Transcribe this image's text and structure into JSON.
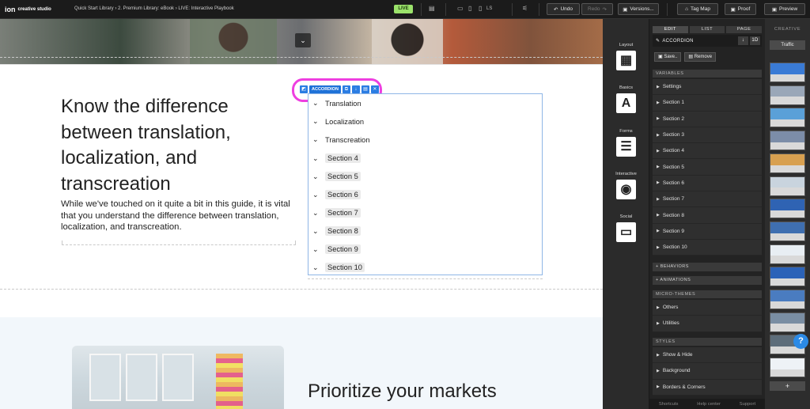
{
  "topbar": {
    "logo": "ion",
    "logo_sub": "creative studio",
    "breadcrumb": "Quick Start Library  ›  2. Premium Library: eBook  ›  LIVE: Interactive Playbook",
    "live_badge": "LIVE",
    "device_label": "LS",
    "undo": "Undo",
    "redo": "Redo",
    "versions": "Versions...",
    "tag_map": "Tag Map",
    "proof": "Proof",
    "preview": "Preview"
  },
  "canvas": {
    "headline": "Know the difference between translation, localization, and transcreation",
    "body": "While we've touched on it quite a bit in this guide, it is vital that you understand the difference between translation, localization, and transcreation.",
    "toolbar_label": "ACCORDION",
    "accordion_items": [
      "Translation",
      "Localization",
      "Transcreation",
      "Section 4",
      "Section 5",
      "Section 6",
      "Section 7",
      "Section 8",
      "Section 9",
      "Section 10"
    ],
    "second_headline": "Prioritize your markets"
  },
  "element_panel": {
    "groups": [
      {
        "label": "Layout",
        "icon": "layout-icon"
      },
      {
        "label": "Basics",
        "icon": "text-icon",
        "glyph": "A"
      },
      {
        "label": "Forms",
        "icon": "form-icon"
      },
      {
        "label": "Interactive",
        "icon": "play-icon"
      },
      {
        "label": "Social",
        "icon": "chat-icon"
      }
    ]
  },
  "right_panel": {
    "tabs": [
      "EDIT",
      "LIST",
      "PAGE"
    ],
    "element_name": "ACCORDION",
    "badge_1d": "1D",
    "save": "Save..",
    "remove": "Remove",
    "variables_title": "VARIABLES",
    "variables": [
      "Settings",
      "Section 1",
      "Section 2",
      "Section 3",
      "Section 4",
      "Section 5",
      "Section 6",
      "Section 7",
      "Section 8",
      "Section 9",
      "Section 10"
    ],
    "behaviors": "+ BEHAVIORS",
    "animations": "+ ANIMATIONS",
    "micro_title": "MICRO-THEMES",
    "micro": [
      "Others",
      "Utilities"
    ],
    "styles_title": "STYLES",
    "styles": [
      "Show & Hide",
      "Background",
      "Borders & Corners"
    ],
    "footer": [
      "Shortcuts",
      "Help center",
      "Support"
    ]
  },
  "creative_panel": {
    "title": "CREATIVE",
    "traffic": "Traffic",
    "add": "+",
    "thumb_colors": [
      "#3a7bd5",
      "#9aa7b8",
      "#5aa0d8",
      "#7c8da8",
      "#d8a050",
      "#c9d4de",
      "#2f63b3",
      "#3f6fb0",
      "#e8eef3",
      "#2b62b8",
      "#4a7cc0",
      "#7a8ea3",
      "#5d6d7a",
      "#eef2f6"
    ]
  },
  "help": "?"
}
